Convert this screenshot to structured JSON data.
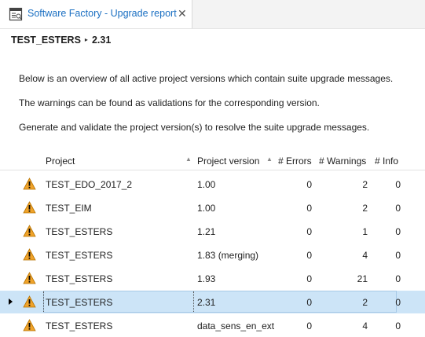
{
  "tab": {
    "title": "Software Factory - Upgrade report",
    "close_glyph": "✕",
    "icon": "report-icon"
  },
  "breadcrumb": {
    "project": "TEST_ESTERS",
    "separator": "▸",
    "version": "2.31"
  },
  "description": [
    "Below is an overview of all active project versions which contain suite upgrade messages.",
    "The warnings can be found as validations for the corresponding version.",
    "Generate and validate the project version(s) to resolve the suite upgrade messages."
  ],
  "table": {
    "columns": {
      "project": "Project",
      "version": "Project version",
      "errors": "# Errors",
      "warnings": "# Warnings",
      "info": "# Info"
    },
    "sort_glyph": "▲",
    "rows": [
      {
        "project": "TEST_EDO_2017_2",
        "version": "1.00",
        "errors": "0",
        "warnings": "2",
        "info": "0",
        "icon": "warning-icon"
      },
      {
        "project": "TEST_EIM",
        "version": "1.00",
        "errors": "0",
        "warnings": "2",
        "info": "0",
        "icon": "warning-icon"
      },
      {
        "project": "TEST_ESTERS",
        "version": "1.21",
        "errors": "0",
        "warnings": "1",
        "info": "0",
        "icon": "warning-icon"
      },
      {
        "project": "TEST_ESTERS",
        "version": "1.83 (merging)",
        "errors": "0",
        "warnings": "4",
        "info": "0",
        "icon": "warning-icon"
      },
      {
        "project": "TEST_ESTERS",
        "version": "1.93",
        "errors": "0",
        "warnings": "21",
        "info": "0",
        "icon": "warning-icon"
      },
      {
        "project": "TEST_ESTERS",
        "version": "2.31",
        "errors": "0",
        "warnings": "2",
        "info": "0",
        "icon": "warning-icon",
        "selected": true
      },
      {
        "project": "TEST_ESTERS",
        "version": "data_sens_en_ext",
        "errors": "0",
        "warnings": "4",
        "info": "0",
        "icon": "warning-icon"
      }
    ]
  },
  "colors": {
    "accent": "#1a6fc2",
    "selection": "#cce4f7",
    "warning": "#f0a32a"
  }
}
